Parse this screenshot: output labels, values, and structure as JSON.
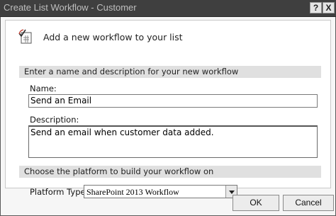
{
  "window": {
    "title": "Create List Workflow - Customer",
    "help_glyph": "?",
    "close_glyph": "X"
  },
  "header": {
    "icon": "workflow-icon",
    "text": "Add a new workflow to your list"
  },
  "section_name": {
    "title": "Enter a name and description for your new workflow",
    "name_label": "Name:",
    "name_value": "Send an Email",
    "description_label": "Description:",
    "description_value": "Send an email when customer data added."
  },
  "section_platform": {
    "title": "Choose the platform to build your workflow on",
    "platform_label": "Platform Type:",
    "platform_value": "SharePoint 2013 Workflow"
  },
  "buttons": {
    "ok": "OK",
    "cancel": "Cancel"
  }
}
